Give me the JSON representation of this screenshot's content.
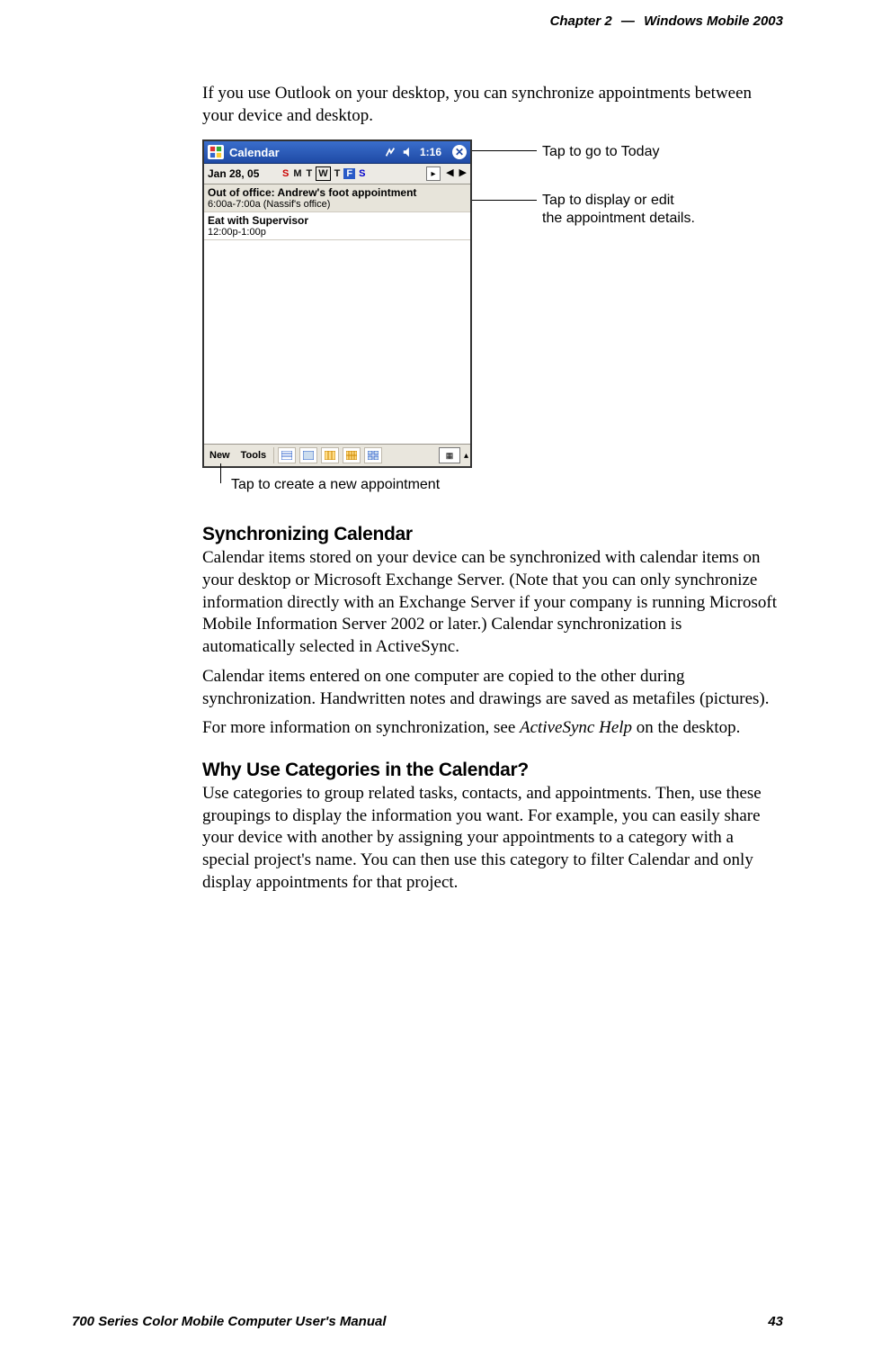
{
  "header": {
    "chapter": "Chapter  2",
    "separator": "—",
    "title": "Windows Mobile 2003"
  },
  "intro": "If you use Outlook on your desktop, you can synchronize appointments between your device and desktop.",
  "device": {
    "titlebar": {
      "app": "Calendar",
      "time": "1:16"
    },
    "datebar": {
      "date": "Jan 28, 05",
      "days": {
        "sun": "S",
        "mon": "M",
        "tue": "T",
        "wed": "W",
        "thu": "T",
        "fri": "F",
        "sat": "S"
      }
    },
    "appts": [
      {
        "title": "Out of office: Andrew's foot appointment",
        "sub": "6:00a-7:00a (Nassif's office)"
      },
      {
        "title": "Eat with Supervisor",
        "sub": "12:00p-1:00p"
      }
    ],
    "toolbar": {
      "new": "New",
      "tools": "Tools"
    }
  },
  "callouts": {
    "today": "Tap to go to Today",
    "edit1": "Tap to display or edit",
    "edit2": "the appointment details.",
    "newappt": "Tap to create a new appointment"
  },
  "sections": {
    "syncTitle": "Synchronizing Calendar",
    "syncP1": "Calendar items stored on your device can be synchronized with calendar items on your desktop or Microsoft Exchange Server. (Note that you can only synchronize information directly with an Exchange Server if your company is running Microsoft Mobile Information Server 2002 or later.) Calendar synchronization is automatically selected in ActiveSync.",
    "syncP2": "Calendar items entered on one computer are copied to the other during synchronization. Handwritten notes and drawings are saved as metafiles (pictures).",
    "syncP3a": "For more information on synchronization, see ",
    "syncP3i": "ActiveSync Help",
    "syncP3b": " on the desktop.",
    "catTitle": "Why Use Categories in the Calendar?",
    "catP1": "Use categories to group related tasks, contacts, and appointments. Then, use these groupings to display the information you want. For example, you can easily share your device with another by assigning your appointments to a category with a special project's name. You can then use this category to filter Calendar and only display appointments for that project."
  },
  "footer": {
    "left": "700 Series Color Mobile Computer User's Manual",
    "right": "43"
  }
}
